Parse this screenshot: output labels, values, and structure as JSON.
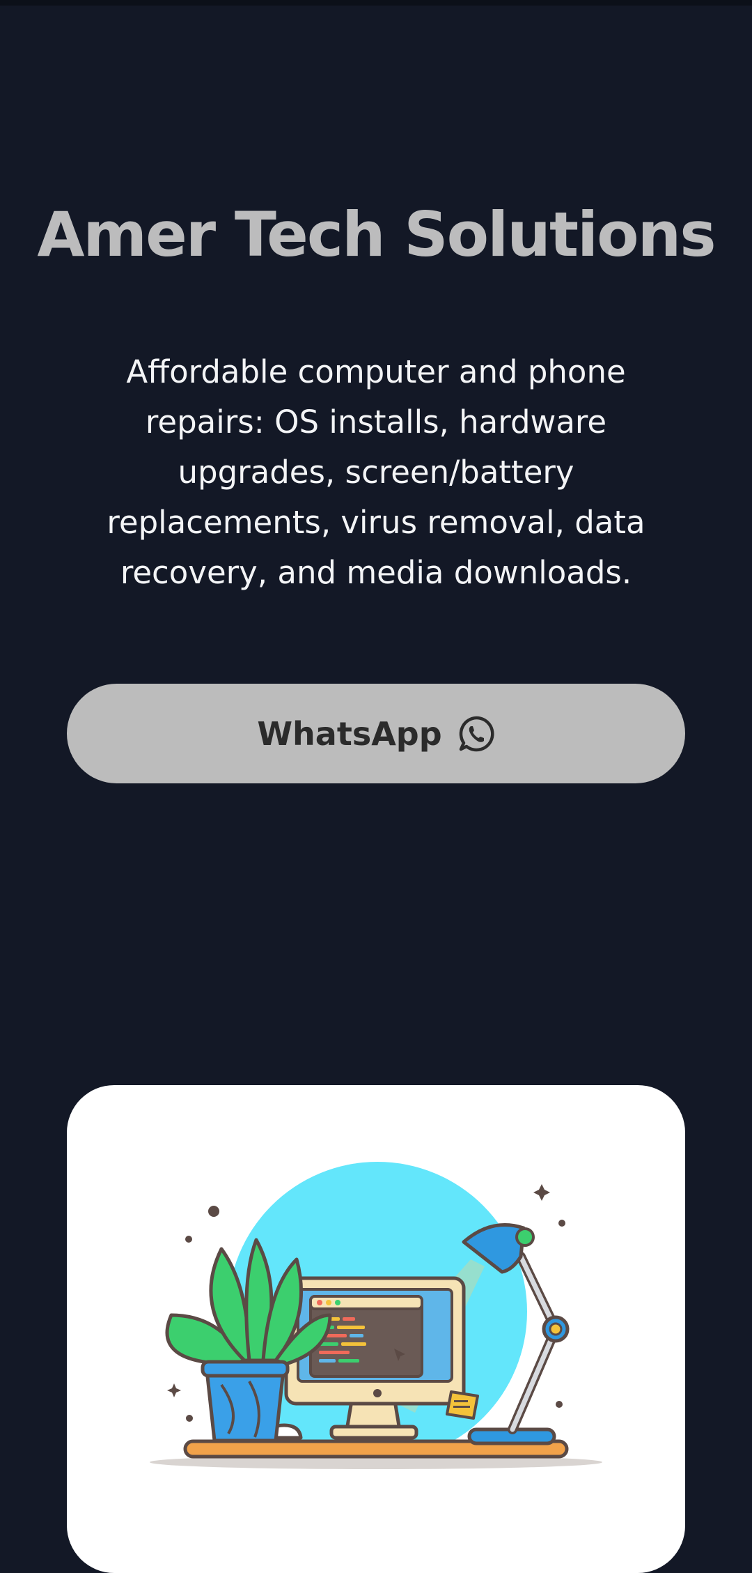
{
  "hero": {
    "title": "Amer Tech Solutions",
    "description": "Affordable computer and phone repairs: OS installs, hardware upgrades, screen/battery replacements, virus removal, data recovery, and media downloads."
  },
  "cta": {
    "label": "WhatsApp",
    "icon": "whatsapp-icon"
  },
  "illustration": {
    "icon": "computer-desk-illustration",
    "colors": {
      "circle": "#63e6fb",
      "leaf": "#3ccf6e",
      "pot": "#3aa0e8",
      "lamp": "#2f98e0",
      "desk": "#f2a24a",
      "outline": "#5b4a45"
    }
  },
  "colors": {
    "background": "#131826",
    "title": "#bcbcbd",
    "text": "#f3f4f6",
    "button_bg": "#bcbcbc",
    "button_text": "#2b2b2b",
    "card_bg": "#ffffff"
  }
}
